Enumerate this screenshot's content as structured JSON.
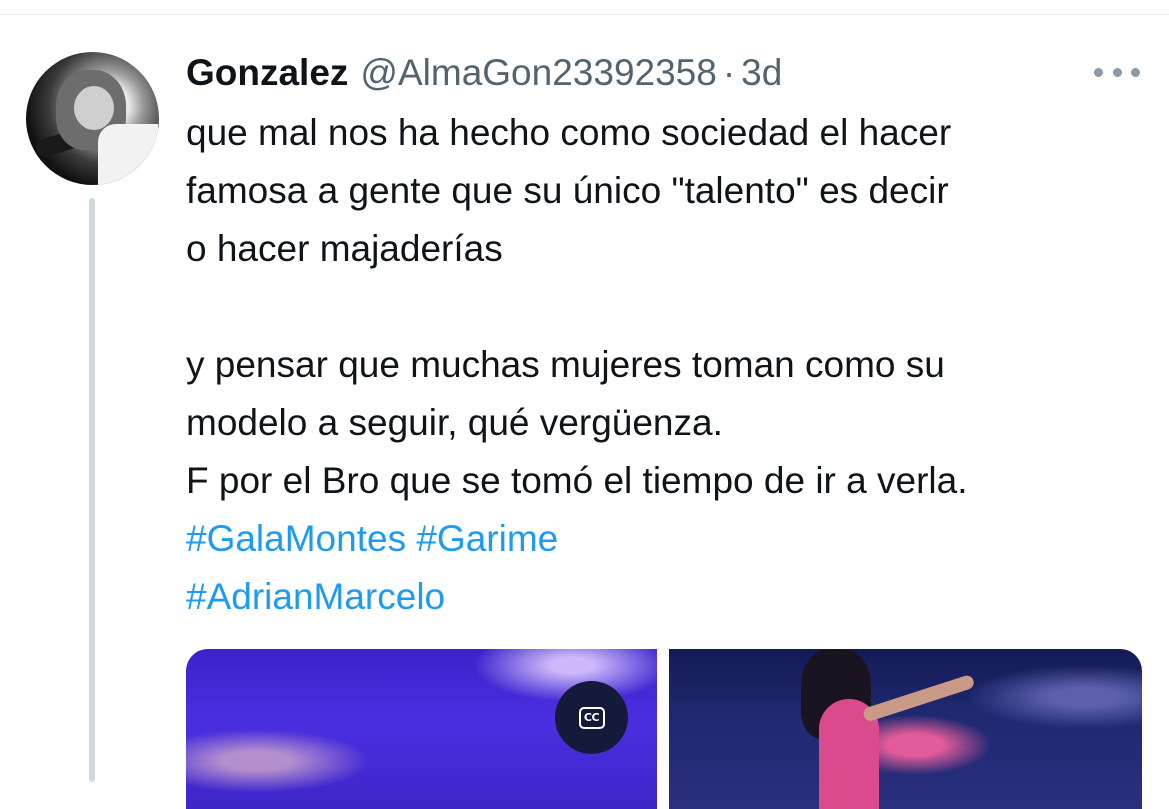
{
  "tweet": {
    "author": {
      "display_name": "Gonzalez",
      "handle": "@AlmaGon23392358",
      "separator": "·",
      "time": "3d"
    },
    "text_lines": [
      "que mal nos ha hecho como sociedad el hacer",
      "famosa a gente que su único \"talento\" es decir",
      "o hacer majaderías",
      "",
      "y pensar que muchas mujeres toman como su",
      "modelo a seguir, qué vergüenza.",
      "F por el Bro que se tomó el tiempo de ir a verla."
    ],
    "hashtags_line1": [
      "#GalaMontes",
      "#Garime"
    ],
    "hashtags_line2": [
      "#AdrianMarcelo"
    ],
    "media": {
      "cc_label": "CC"
    }
  },
  "icons": {
    "more": "more-horizontal-icon",
    "captions": "closed-captions-icon",
    "avatar": "profile-avatar"
  },
  "colors": {
    "text": "#0f1419",
    "secondary": "#536471",
    "link": "#1d9bf0",
    "thread_line": "#cfd9de"
  }
}
